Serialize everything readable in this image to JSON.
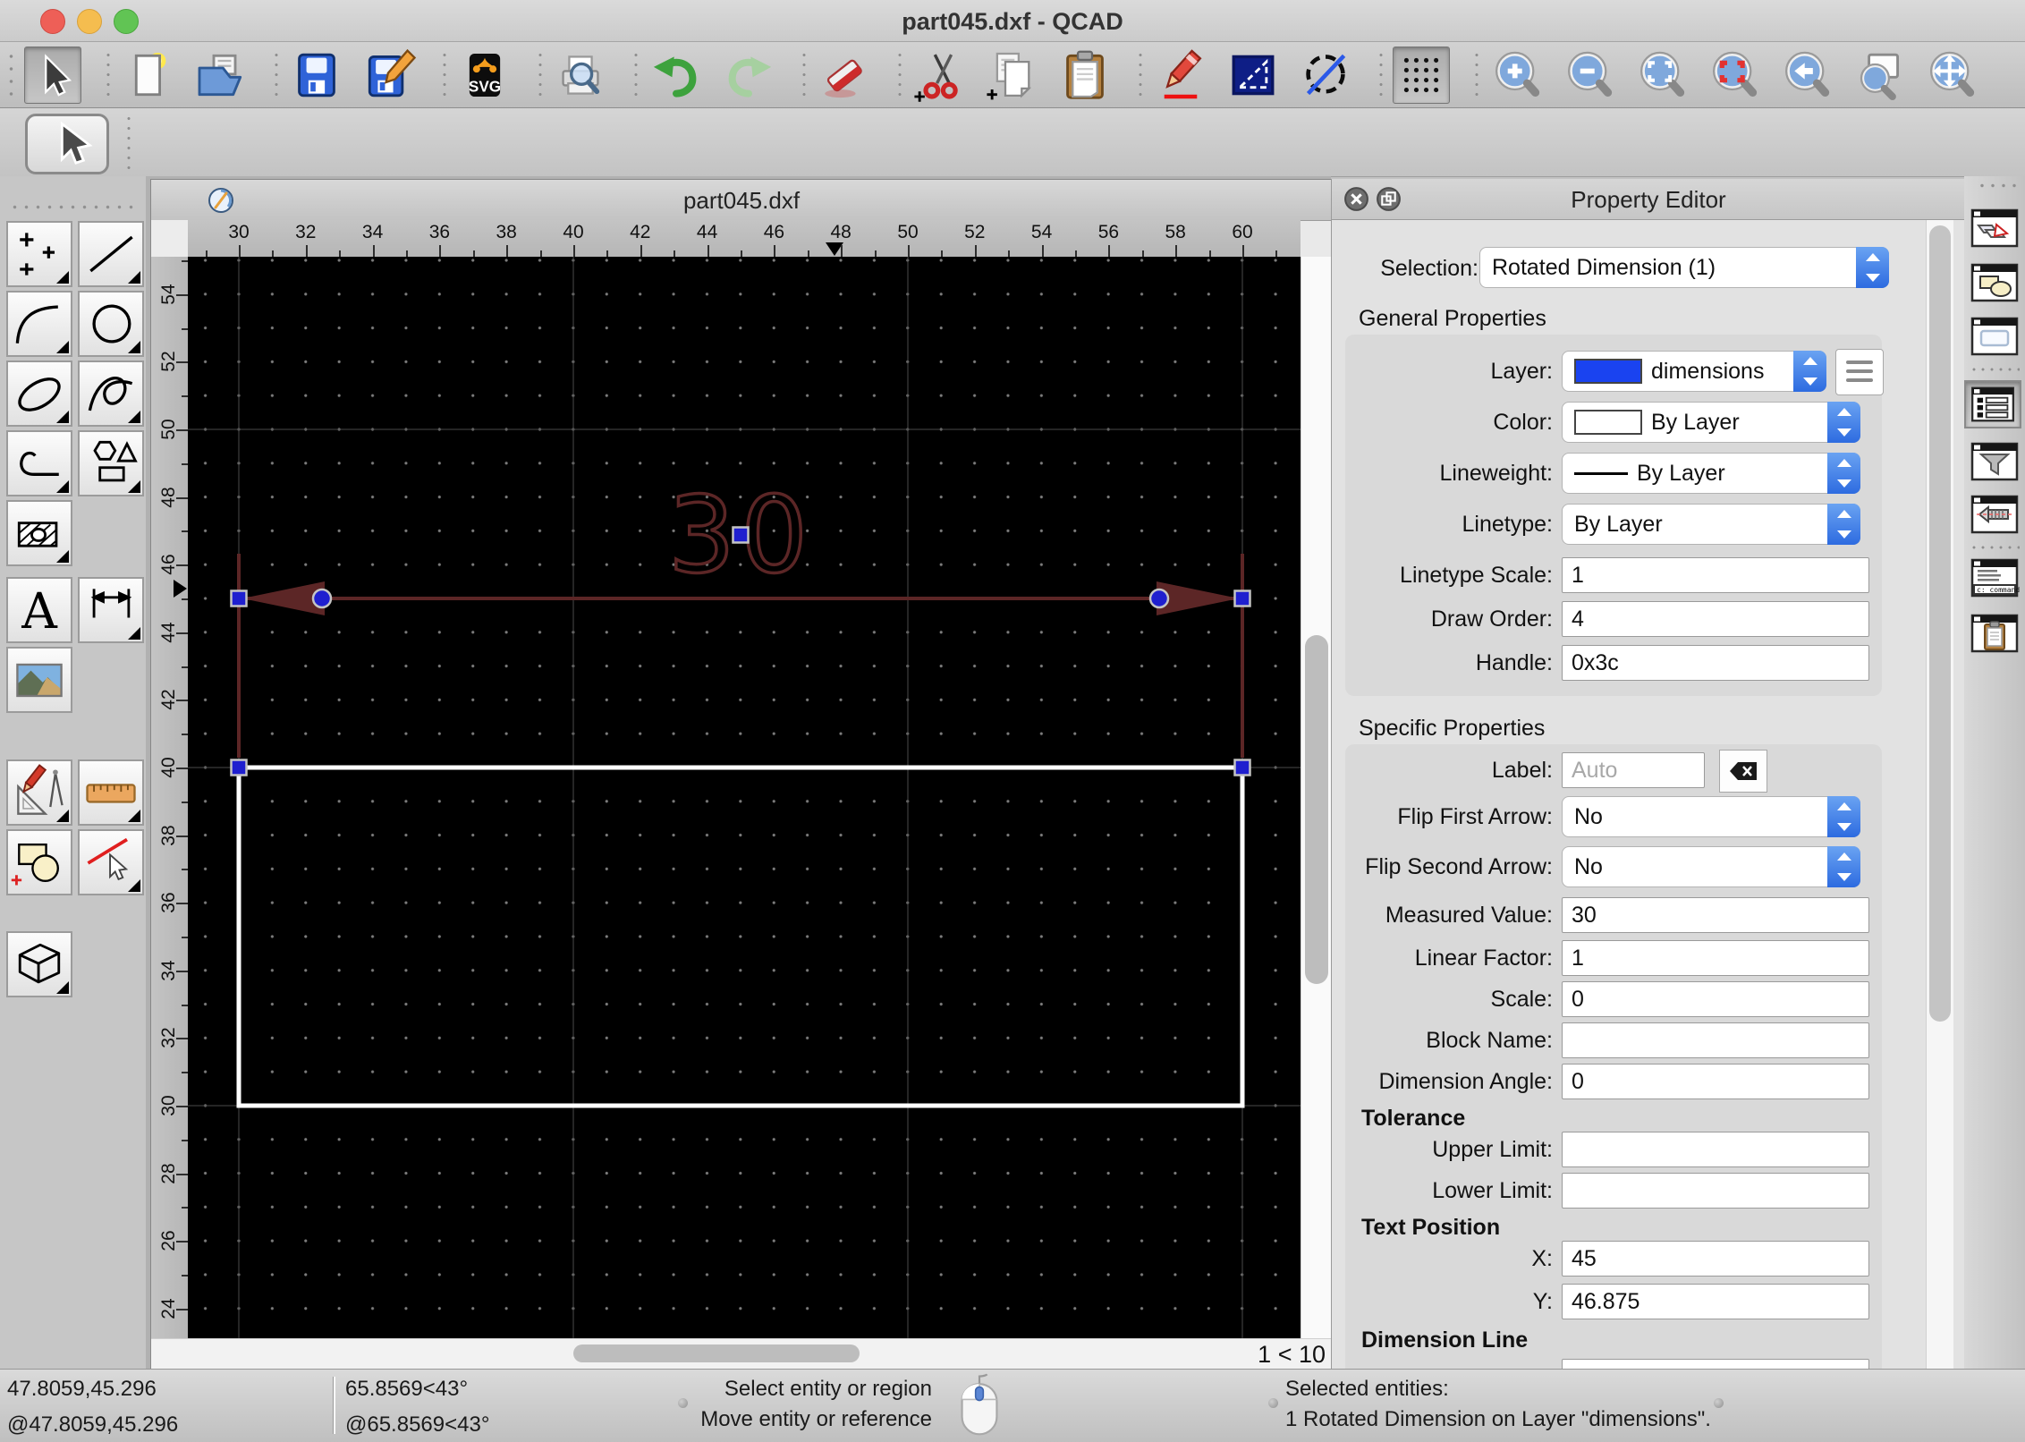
{
  "app": {
    "window_title": "part045.dxf - QCAD"
  },
  "toolbar": {
    "svg_badge": "SVG",
    "items": [
      "selection-arrow",
      "new-file",
      "open-file",
      "save",
      "save-as",
      "svg-export",
      "print-preview",
      "undo",
      "redo",
      "delete",
      "cut",
      "copy",
      "paste",
      "modify",
      "selection-tools",
      "deselect-all",
      "grid-toggle",
      "zoom-in",
      "zoom-out",
      "auto-zoom",
      "zoom-selection",
      "previous-view",
      "zoom-window",
      "pan"
    ]
  },
  "palette": {
    "items": [
      "points",
      "line",
      "arc",
      "circle",
      "ellipse",
      "spline",
      "polyline",
      "shapes",
      "hatch",
      "text",
      "dimension",
      "image",
      "modify-tools",
      "measure",
      "block",
      "modify-line",
      "box3d"
    ]
  },
  "doc": {
    "title": "part045.dxf",
    "zoom_ratio": "1 < 10"
  },
  "rulers": {
    "horizontal": [
      30,
      32,
      34,
      36,
      38,
      40,
      42,
      44,
      46,
      48,
      50,
      52,
      54,
      56,
      58,
      60
    ],
    "vertical": [
      54,
      52,
      50,
      48,
      46,
      44,
      42,
      40,
      38,
      36,
      34,
      32,
      30,
      28,
      26,
      24
    ]
  },
  "canvas": {
    "dimension_label": "30"
  },
  "property_editor": {
    "title": "Property Editor",
    "selection_label": "Selection:",
    "selection_value": "Rotated Dimension (1)",
    "general": {
      "heading": "General Properties",
      "layer_label": "Layer:",
      "layer_value": "dimensions",
      "color_label": "Color:",
      "color_value": "By Layer",
      "lineweight_label": "Lineweight:",
      "lineweight_value": "By Layer",
      "linetype_label": "Linetype:",
      "linetype_value": "By Layer",
      "linetype_scale_label": "Linetype Scale:",
      "linetype_scale_value": "1",
      "draw_order_label": "Draw Order:",
      "draw_order_value": "4",
      "handle_label": "Handle:",
      "handle_value": "0x3c"
    },
    "specific": {
      "heading": "Specific Properties",
      "label_label": "Label:",
      "label_placeholder": "Auto",
      "flip_first_label": "Flip First Arrow:",
      "flip_first_value": "No",
      "flip_second_label": "Flip Second Arrow:",
      "flip_second_value": "No",
      "measured_label": "Measured Value:",
      "measured_value": "30",
      "linear_factor_label": "Linear Factor:",
      "linear_factor_value": "1",
      "scale_label": "Scale:",
      "scale_value": "0",
      "block_name_label": "Block Name:",
      "block_name_value": "",
      "dim_angle_label": "Dimension Angle:",
      "dim_angle_value": "0",
      "tolerance_heading": "Tolerance",
      "upper_label": "Upper Limit:",
      "upper_value": "",
      "lower_label": "Lower Limit:",
      "lower_value": "",
      "text_position_heading": "Text Position",
      "x_label": "X:",
      "x_value": "45",
      "y_label": "Y:",
      "y_value": "46.875",
      "dimension_line_heading": "Dimension Line"
    }
  },
  "sidebar": {
    "items": [
      "layer-list",
      "block-list",
      "view-list",
      "property-editor",
      "selection-filter",
      "library-browser",
      "command-line",
      "clipboard-panel"
    ]
  },
  "status": {
    "coord_abs": "47.8059,45.296",
    "coord_rel": "@47.8059,45.296",
    "polar_abs": "65.8569<43°",
    "polar_rel": "@65.8569<43°",
    "hint_line1": "Select entity or region",
    "hint_line2": "Move entity or reference",
    "selected_heading": "Selected entities:",
    "selected_detail": "1 Rotated Dimension on Layer \"dimensions\"."
  },
  "colors": {
    "accent_blue": "#2d6be0",
    "layer_swatch_blue": "#1a43f0",
    "dimension_maroon": "#5c2626",
    "grip_blue": "#1f1fcf",
    "canvas_bg": "#000000"
  },
  "icons": {
    "selection-arrow-icon": "cursor-arrow",
    "new-file-icon": "blank-page",
    "open-file-icon": "folder",
    "save-icon": "floppy-disk",
    "save-as-icon": "floppy-pencil",
    "svg-export-icon": "svg-badge",
    "print-preview-icon": "printer-magnifier",
    "undo-icon": "curved-arrow-left",
    "redo-icon": "curved-arrow-right",
    "delete-icon": "eraser",
    "cut-icon": "scissors",
    "copy-icon": "two-pages",
    "paste-icon": "clipboard",
    "modify-icon": "red-pencil",
    "selection-tools-icon": "dashed-triangle",
    "deselect-all-icon": "circle-slash",
    "grid-toggle-icon": "dot-grid",
    "zoom-in-icon": "magnifier-plus",
    "zoom-out-icon": "magnifier-minus",
    "auto-zoom-icon": "magnifier-brackets",
    "zoom-selection-icon": "magnifier-red-brackets",
    "previous-view-icon": "magnifier-left-arrow",
    "zoom-window-icon": "magnifier-page",
    "pan-icon": "magnifier-arrows",
    "mouse-icon": "mouse",
    "qcad-logo-icon": "qcad-logo",
    "close-icon": "circle-x",
    "undock-icon": "overlap-squares",
    "backspace-icon": "backspace"
  }
}
